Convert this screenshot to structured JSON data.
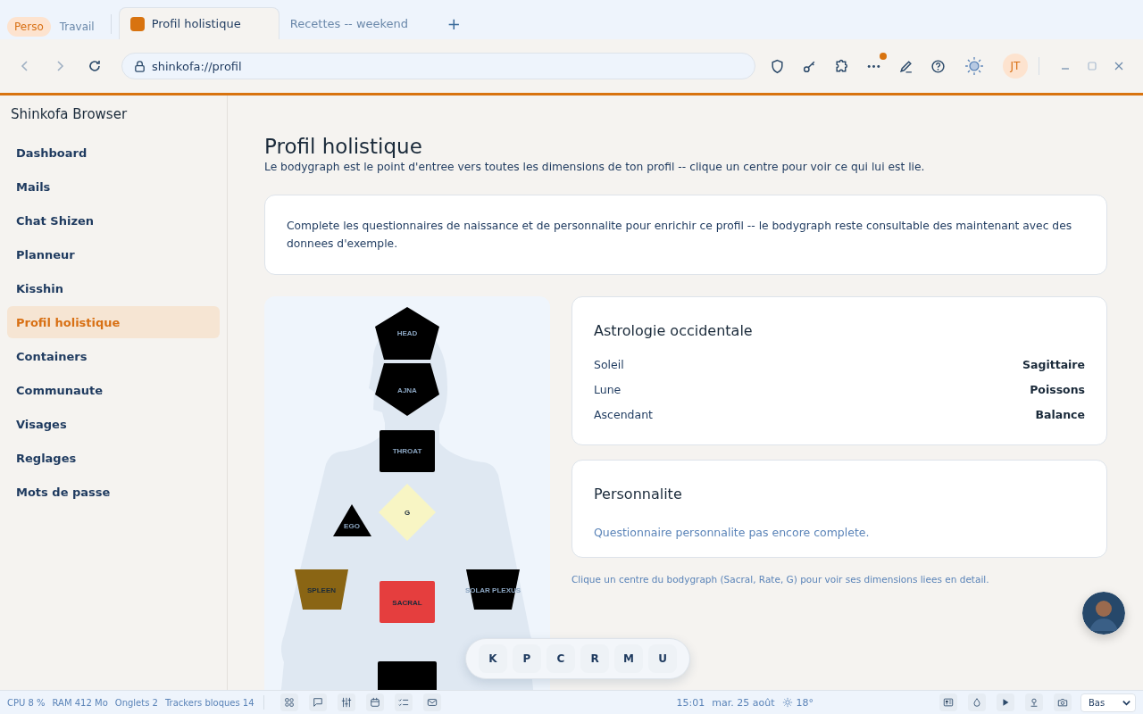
{
  "workspaces": [
    {
      "label": "Perso",
      "selected": true
    },
    {
      "label": "Travail",
      "selected": false
    }
  ],
  "tabs": [
    {
      "title": "Profil holistique",
      "selected": true
    },
    {
      "title": "Recettes -- weekend",
      "selected": false
    }
  ],
  "new_tab": "+",
  "address": "shinkofa://profil",
  "toolbar": {
    "more_notification": true,
    "user_initials": "JT"
  },
  "sidebar": {
    "title": "Shinkofa Browser",
    "items": [
      {
        "label": "Dashboard",
        "selected": false
      },
      {
        "label": "Mails",
        "selected": false
      },
      {
        "label": "Chat Shizen",
        "selected": false
      },
      {
        "label": "Planneur",
        "selected": false
      },
      {
        "label": "Kisshin",
        "selected": false
      },
      {
        "label": "Profil holistique",
        "selected": true
      },
      {
        "label": "Containers",
        "selected": false
      },
      {
        "label": "Communaute",
        "selected": false
      },
      {
        "label": "Visages",
        "selected": false
      },
      {
        "label": "Reglages",
        "selected": false
      },
      {
        "label": "Mots de passe",
        "selected": false
      }
    ]
  },
  "page": {
    "title": "Profil holistique",
    "subtitle": "Le bodygraph est le point d'entree vers toutes les dimensions de ton profil -- clique un centre pour voir ce qui lui est lie.",
    "notice": "Complete les questionnaires de naissance et de personnalite pour enrichir ce profil -- le bodygraph reste consultable des maintenant avec des donnees d'exemple."
  },
  "bodygraph": {
    "centers": [
      {
        "label": "HEAD",
        "kind": "pentagon-up",
        "color": "#000000"
      },
      {
        "label": "AJNA",
        "kind": "pentagon-down",
        "color": "#000000"
      },
      {
        "label": "THROAT",
        "kind": "throat",
        "color": "#000000"
      },
      {
        "label": "G",
        "kind": "diamond",
        "color": "#f8f5c4"
      },
      {
        "label": "EGO",
        "kind": "triangle",
        "color": "#000000"
      },
      {
        "label": "SPLEEN",
        "kind": "spleen",
        "color": "#8a6514"
      },
      {
        "label": "SACRAL",
        "kind": "sacral",
        "color": "#e53e3e"
      },
      {
        "label": "SOLAR PLEXUS",
        "kind": "solar",
        "color": "#000000"
      },
      {
        "kind": "root",
        "color": "#000000"
      }
    ]
  },
  "astrology": {
    "title": "Astrologie occidentale",
    "rows": [
      {
        "label": "Soleil",
        "value": "Sagittaire"
      },
      {
        "label": "Lune",
        "value": "Poissons"
      },
      {
        "label": "Ascendant",
        "value": "Balance"
      }
    ]
  },
  "personality": {
    "title": "Personnalite",
    "message": "Questionnaire personnalite pas encore complete."
  },
  "hint": "Clique un centre du bodygraph (Sacral, Rate, G) pour voir ses dimensions liees en detail.",
  "quick_nav": [
    "K",
    "P",
    "C",
    "R",
    "M",
    "U"
  ],
  "status_bar": {
    "stats": [
      "CPU 8 %",
      "RAM 412 Mo",
      "Onglets 2",
      "Trackers bloques 14"
    ],
    "time": "15:01",
    "date": "mar. 25 août",
    "weather": "18°",
    "position": "Bas"
  }
}
